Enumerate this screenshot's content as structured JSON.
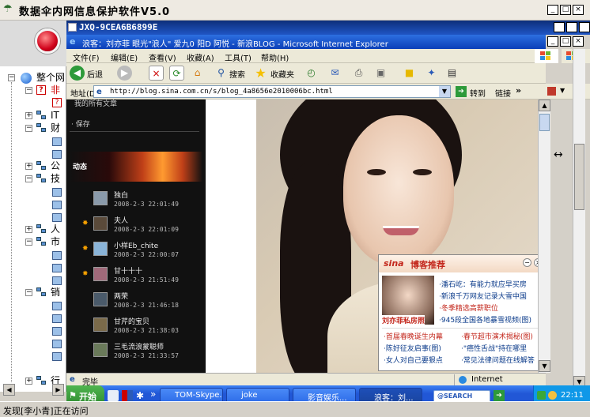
{
  "outer_window": {
    "title": "数据伞内网信息保护软件V5.0",
    "status_text": "发现[李小青]正在访问"
  },
  "inner_window": {
    "title": "JXQ-9CEA6B6899E"
  },
  "tree": [
    {
      "label": "整个网",
      "level": 0
    },
    {
      "label": "非",
      "level": 1
    },
    {
      "label": "IT",
      "level": 1
    },
    {
      "label": "财",
      "level": 1
    },
    {
      "label": "公",
      "level": 1
    },
    {
      "label": "技",
      "level": 1
    },
    {
      "label": "人",
      "level": 1
    },
    {
      "label": "市",
      "level": 1
    },
    {
      "label": "销",
      "level": 1
    },
    {
      "label": "行",
      "level": 1
    }
  ],
  "browser": {
    "title": "浪客：刘亦菲 眼光\"浪人\" 爱九0 阳D 阿悦 - 新浪BLOG - Microsoft Internet Explorer",
    "menu": [
      "文件(F)",
      "编辑(E)",
      "查看(V)",
      "收藏(A)",
      "工具(T)",
      "帮助(H)"
    ],
    "toolbar": {
      "back": "后退",
      "search": "搜索",
      "favorites": "收藏夹"
    },
    "address_label": "地址(D)",
    "url": "http://blog.sina.com.cn/s/blog_4a8656e2010006bc.html",
    "go": "转到",
    "links": "链接",
    "status": "完毕",
    "zone": "Internet"
  },
  "blog": {
    "side_top": "我的所有文章",
    "side_link": "·  保存",
    "section": "动态",
    "feed": [
      {
        "name": "独白",
        "time": "2008-2-3 22:01:49",
        "star": false
      },
      {
        "name": "夫人",
        "time": "2008-2-3 22:01:09",
        "star": true
      },
      {
        "name": "小样Eb_chite",
        "time": "2008-2-3 22:00:07",
        "star": true
      },
      {
        "name": "甘十十十",
        "time": "2008-2-3 21:51:49",
        "star": true
      },
      {
        "name": "两荣",
        "time": "2008-2-3 21:46:18",
        "star": false
      },
      {
        "name": "甘芹的宝贝",
        "time": "2008-2-3 21:38:03",
        "star": false
      },
      {
        "name": "三毛流浪蒙聪师",
        "time": "2008-2-3 21:33:57",
        "star": false
      }
    ]
  },
  "popup": {
    "brand": "sina",
    "title": "博客推荐",
    "photo_caption": "刘亦菲私房照",
    "items": [
      {
        "text": "·潘石屹：有能力就应早买房",
        "red": false
      },
      {
        "text": "·新浪千万网友记录大雪中国",
        "red": false
      },
      {
        "text": "·冬季精选高薪职位",
        "red": true
      },
      {
        "text": "·945段全国各地暴雪视频(图)",
        "red": false
      }
    ],
    "grid": [
      [
        "·首届春晚诞生内幕",
        "·春节超市演术揭秘(图)"
      ],
      [
        "·陈好征友启事(图)",
        "·\"癌性舌战\"持在哪里"
      ],
      [
        "·女人对自己要狠点",
        "·常见法律问题在线解答"
      ]
    ]
  },
  "taskbar": {
    "start": "开始",
    "tasks": [
      "TOM-Skype...",
      "joke",
      "影音娱乐...",
      "浪客：刘..."
    ],
    "search": "@SEARCH",
    "clock": "22:11"
  }
}
